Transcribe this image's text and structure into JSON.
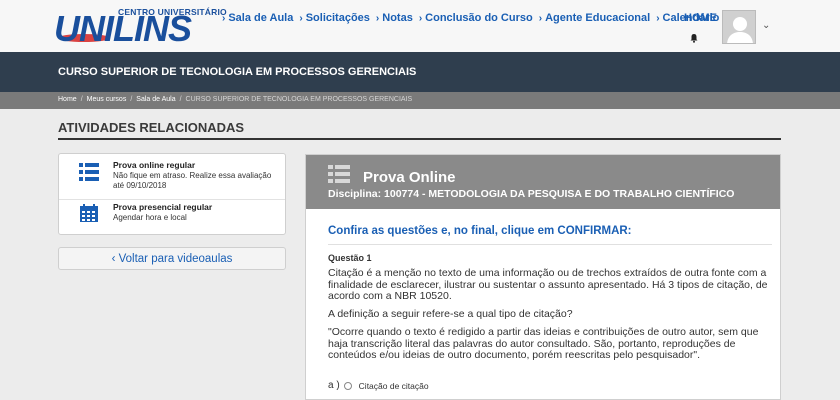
{
  "header": {
    "logo_small": "CENTRO UNIVERSITÁRIO",
    "logo_big": "UNILINS",
    "nav": [
      {
        "label": "Sala de Aula"
      },
      {
        "label": "Solicitações"
      },
      {
        "label": "Notas"
      },
      {
        "label": "Conclusão do Curso"
      },
      {
        "label": "Agente Educacional"
      },
      {
        "label": "Calendário"
      }
    ],
    "home": "HOME"
  },
  "course": {
    "title": "CURSO SUPERIOR DE TECNOLOGIA EM PROCESSOS GERENCIAIS"
  },
  "breadcrumb": {
    "items": [
      "Home",
      "Meus cursos",
      "Sala de Aula",
      "CURSO SUPERIOR DE TECNOLOGIA EM PROCESSOS GERENCIAIS"
    ],
    "sep": "/"
  },
  "sidebar": {
    "heading": "ATIVIDADES RELACIONADAS",
    "items": [
      {
        "title": "Prova online regular",
        "line1": "Não fique em atraso. Realize essa avaliação",
        "line2": "até 09/10/2018"
      },
      {
        "title": "Prova presencial regular",
        "line1": "Agendar hora e local"
      }
    ],
    "back_label": "Voltar para videoaulas"
  },
  "exam": {
    "title": "Prova Online",
    "subject": "Disciplina: 100774 - METODOLOGIA DA PESQUISA E DO TRABALHO CIENTÍFICO",
    "instruction": "Confira as questões e, no final, clique em CONFIRMAR:",
    "question_label": "Questão 1",
    "paragraph1": "Citação é a menção no texto de uma informação ou de trechos extraídos de outra fonte com a finalidade de esclarecer, ilustrar ou sustentar o assunto apresentado. Há 3 tipos de citação, de acordo com a NBR 10520.",
    "paragraph2": "A definição a seguir refere-se a qual tipo de citação?",
    "paragraph3": "\"Ocorre quando o texto é redigido a partir das ideias e contribuições de outro autor, sem que haja transcrição literal das palavras do autor consultado. São, portanto, reproduções de conteúdos e/ou ideias de outro documento, porém reescritas pelo pesquisador\".",
    "options": [
      {
        "letter": "a )",
        "text": "Citação de citação"
      }
    ]
  },
  "colors": {
    "accent": "#1a5fb4",
    "band": "#2f3e4e",
    "panel_header": "#8a8a8a"
  }
}
